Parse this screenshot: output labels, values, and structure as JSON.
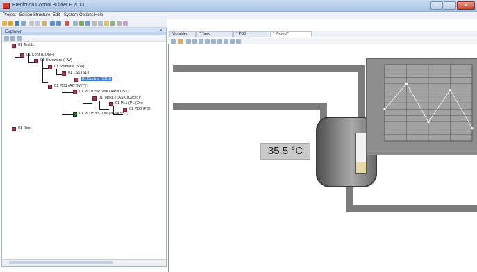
{
  "window": {
    "title": "Prediction Control Builder F 2013"
  },
  "menu": [
    "Project",
    "Edition",
    "Structure",
    "Edit",
    "System",
    "Options",
    "Help"
  ],
  "explorer": {
    "title": "Explorer",
    "tree": [
      {
        "id": "n0",
        "label": "01  Test11"
      },
      {
        "id": "n1",
        "label": "01  Conf  (CONF)"
      },
      {
        "id": "n2",
        "label": "01  Hardware  (HW)"
      },
      {
        "id": "n3",
        "label": "01  Software  (SW)"
      },
      {
        "id": "n4",
        "label": "01  LS1  (SD)"
      },
      {
        "id": "n5",
        "label": "01  Control  (CDU)"
      },
      {
        "id": "n6",
        "label": "01  PO1  (ACTIVITY)"
      },
      {
        "id": "n7",
        "label": "01  PO1USRTask  (TASKUST)"
      },
      {
        "id": "n8",
        "label": "01  Task1  (TASK (Cyclic)*)"
      },
      {
        "id": "n9",
        "label": "01  PL1  (PL (On)"
      },
      {
        "id": "n10",
        "label": "01  PB3  (PB)"
      },
      {
        "id": "n11",
        "label": "01  PO1SYSTask  (TASKSST)"
      },
      {
        "id": "n12",
        "label": "01  Root"
      }
    ]
  },
  "tabs": [
    {
      "label": "Variables"
    },
    {
      "label": "* Task"
    },
    {
      "label": "* PB3"
    },
    {
      "label": "* Project*"
    }
  ],
  "process": {
    "temperature": "35.5 °C",
    "tank_level": 0.3
  },
  "chart_data": {
    "type": "line",
    "title": "",
    "series": [
      {
        "values": [
          5,
          9,
          3,
          8,
          2
        ]
      }
    ],
    "xlabel": "",
    "ylabel": "",
    "ylim": [
      0,
      12
    ],
    "grid": true
  },
  "colors": {
    "pipe": "#7c7c7c",
    "chart_background": "#8e8e8e",
    "tree_icon": "#a23a55",
    "tree_icon_task": "#1f6a2c",
    "selection": "#3d7bd6"
  }
}
